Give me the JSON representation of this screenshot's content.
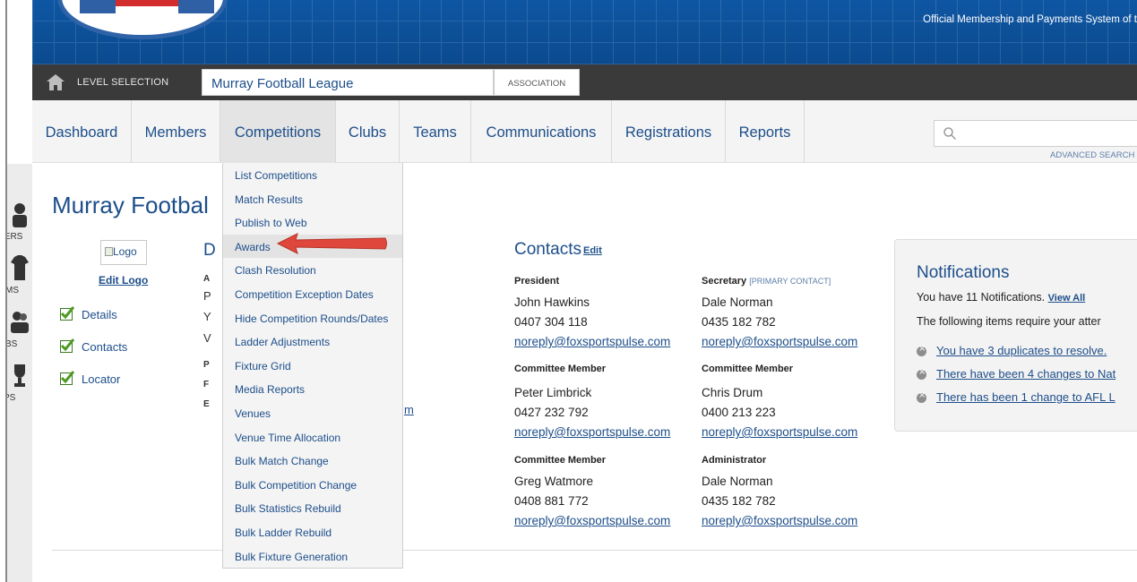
{
  "header": {
    "tagline": "Official Membership and Payments System of t"
  },
  "level_bar": {
    "label": "LEVEL SELECTION",
    "level_name": "Murray Football League",
    "level_type": "ASSOCIATION"
  },
  "nav": {
    "items": [
      {
        "label": "Dashboard"
      },
      {
        "label": "Members"
      },
      {
        "label": "Competitions"
      },
      {
        "label": "Clubs"
      },
      {
        "label": "Teams"
      },
      {
        "label": "Communications"
      },
      {
        "label": "Registrations"
      },
      {
        "label": "Reports"
      }
    ],
    "active": "Competitions",
    "advanced_search": "ADVANCED SEARCH"
  },
  "left_rail": {
    "labels": [
      "IERS",
      "MS",
      "BS",
      "PS"
    ]
  },
  "dropdown": {
    "items": [
      "List Competitions",
      "Match Results",
      "Publish to Web",
      "Awards",
      "Clash Resolution",
      "Competition Exception Dates",
      "Hide Competition Rounds/Dates",
      "Ladder Adjustments",
      "Fixture Grid",
      "Media Reports",
      "Venues",
      "Venue Time Allocation",
      "Bulk Match Change",
      "Bulk Competition Change",
      "Bulk Statistics Rebuild",
      "Bulk Ladder Rebuild",
      "Bulk Fixture Generation"
    ],
    "highlighted": "Awards"
  },
  "main": {
    "title": "Murray Footbal",
    "logo_alt": "Logo",
    "edit_logo": "Edit Logo",
    "checklist": [
      "Details",
      "Contacts",
      "Locator"
    ],
    "partial": {
      "heading": "D",
      "a": "A",
      "p": "P",
      "y": "Y",
      "v": "V",
      "p2": "P",
      "f": "F",
      "e": "E",
      "link_tail": "m"
    }
  },
  "contacts": {
    "title": "Contacts",
    "edit": "Edit",
    "people": [
      {
        "role": "President",
        "role_note": "",
        "name": "John Hawkins",
        "phone": "0407 304 118",
        "email": "noreply@foxsportspulse.com"
      },
      {
        "role": "Secretary",
        "role_note": "[PRIMARY CONTACT]",
        "name": "Dale Norman",
        "phone": "0435 182 782",
        "email": "noreply@foxsportspulse.com"
      },
      {
        "role": "Committee Member",
        "role_note": "",
        "name": "Peter Limbrick",
        "phone": "0427 232 792",
        "email": "noreply@foxsportspulse.com"
      },
      {
        "role": "Committee Member",
        "role_note": "",
        "name": "Chris Drum",
        "phone": "0400 213 223",
        "email": "noreply@foxsportspulse.com"
      },
      {
        "role": "Committee Member",
        "role_note": "",
        "name": "Greg Watmore",
        "phone": "0408 881 772",
        "email": "noreply@foxsportspulse.com"
      },
      {
        "role": "Administrator",
        "role_note": "",
        "name": "Dale Norman",
        "phone": "0435 182 782",
        "email": "noreply@foxsportspulse.com"
      }
    ]
  },
  "notifications": {
    "title": "Notifications",
    "count_text": "You have 11 Notifications.",
    "view_all": "View All",
    "require_text": "The following items require your atter",
    "items": [
      "You have 3 duplicates to resolve.",
      "There have been 4 changes to Nat",
      "There has been 1 change to AFL L"
    ]
  },
  "colors": {
    "header_blue": "#0d4f96",
    "link_blue": "#1d4e8a",
    "level_bar": "#3a3a3a",
    "arrow_red": "#e0473c"
  }
}
